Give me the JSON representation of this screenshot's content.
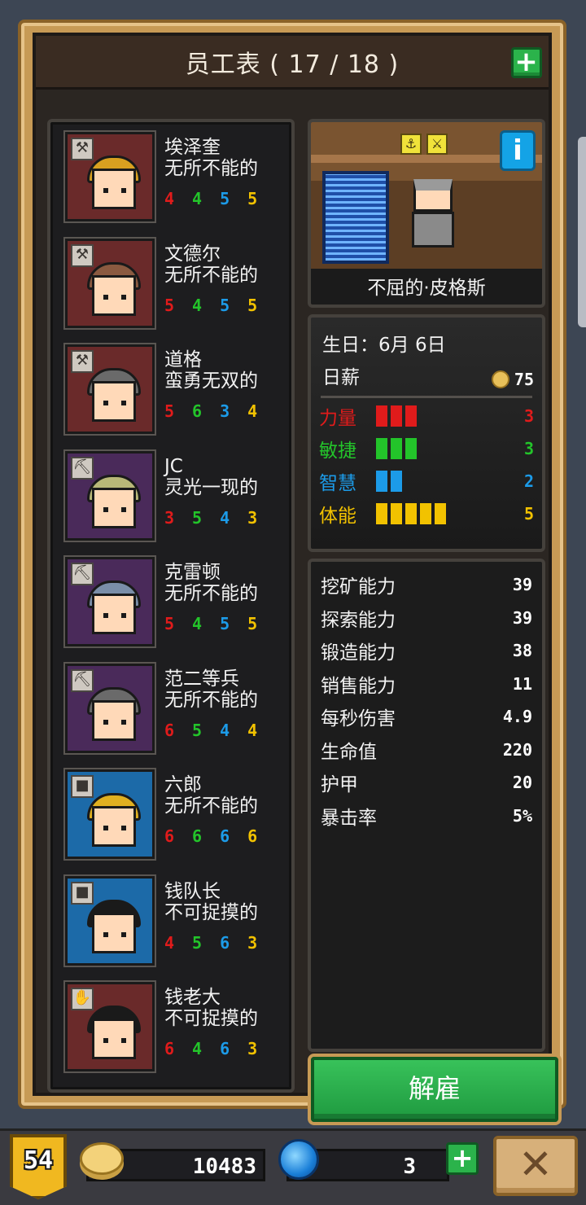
{
  "header": {
    "title": "员工表 ( 17 / 18 )",
    "add_label": "+"
  },
  "employees": [
    {
      "name": "埃泽奎",
      "trait": "无所不能的",
      "stats": [
        "4",
        "4",
        "5",
        "5"
      ],
      "role_icon": "hammer-icon",
      "bg": "#6a2a2a",
      "hat": "#d8a020"
    },
    {
      "name": "文德尔",
      "trait": "无所不能的",
      "stats": [
        "5",
        "4",
        "5",
        "5"
      ],
      "role_icon": "hammer-icon",
      "bg": "#6a2a2a",
      "hat": "#8a5a40"
    },
    {
      "name": "道格",
      "trait": "蛮勇无双的",
      "stats": [
        "5",
        "6",
        "3",
        "4"
      ],
      "role_icon": "hammer-icon",
      "bg": "#6a2a2a",
      "hat": "#6a6a6a"
    },
    {
      "name": "JC",
      "trait": "灵光一现的",
      "stats": [
        "3",
        "5",
        "4",
        "3"
      ],
      "role_icon": "pickaxe-icon",
      "bg": "#4a2a5a",
      "hat": "#b8b878"
    },
    {
      "name": "克雷顿",
      "trait": "无所不能的",
      "stats": [
        "5",
        "4",
        "5",
        "5"
      ],
      "role_icon": "pickaxe-icon",
      "bg": "#4a2a5a",
      "hat": "#7a8ea8"
    },
    {
      "name": "范二等兵",
      "trait": "无所不能的",
      "stats": [
        "6",
        "5",
        "4",
        "4"
      ],
      "role_icon": "pickaxe-icon",
      "bg": "#4a2a5a",
      "hat": "#6a6a6a"
    },
    {
      "name": "六郎",
      "trait": "无所不能的",
      "stats": [
        "6",
        "6",
        "6",
        "6"
      ],
      "role_icon": "boot-icon",
      "bg": "#1c6aa8",
      "hat": "#e0b020"
    },
    {
      "name": "钱队长",
      "trait": "不可捉摸的",
      "stats": [
        "4",
        "5",
        "6",
        "3"
      ],
      "role_icon": "boot-icon",
      "bg": "#1c6aa8",
      "hat": "#1a1a1a"
    },
    {
      "name": "钱老大",
      "trait": "不可捉摸的",
      "stats": [
        "6",
        "4",
        "6",
        "3"
      ],
      "role_icon": "hand-icon",
      "bg": "#6a2a2a",
      "hat": "#1a1a1a"
    }
  ],
  "selected": {
    "name": "不屈的·皮格斯",
    "info_label": "i",
    "birthday": "生日：6月 6日",
    "salary_label": "日薪",
    "salary": "75",
    "attributes": [
      {
        "label": "力量",
        "value": "3",
        "level": 3,
        "color": "#e01b1b"
      },
      {
        "label": "敏捷",
        "value": "3",
        "level": 3,
        "color": "#23c42a"
      },
      {
        "label": "智慧",
        "value": "2",
        "level": 2,
        "color": "#1c9be8"
      },
      {
        "label": "体能",
        "value": "5",
        "level": 5,
        "color": "#f2c200"
      }
    ],
    "abilities": [
      {
        "label": "挖矿能力",
        "value": "39"
      },
      {
        "label": "探索能力",
        "value": "39"
      },
      {
        "label": "锻造能力",
        "value": "38"
      },
      {
        "label": "销售能力",
        "value": "11"
      },
      {
        "label": "每秒伤害",
        "value": "4.9"
      },
      {
        "label": "生命值",
        "value": "220"
      },
      {
        "label": "护甲",
        "value": "20"
      },
      {
        "label": "暴击率",
        "value": "5%"
      }
    ]
  },
  "fire_label": "解雇",
  "footer": {
    "level": "54",
    "gold": "10483",
    "gems": "3",
    "gem_add_label": "+",
    "close_label": "✕"
  },
  "colors": {
    "strength": "#e01b1b",
    "agility": "#23c42a",
    "intellect": "#1c9be8",
    "stamina": "#f2c200",
    "accent_green": "#2bb34b",
    "frame_gold": "#c79a55"
  }
}
